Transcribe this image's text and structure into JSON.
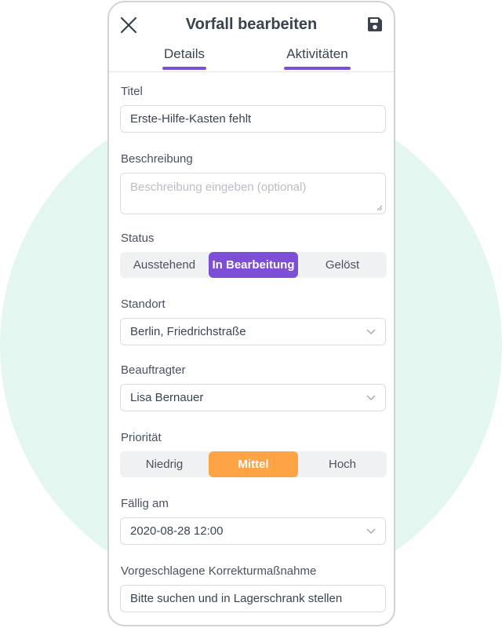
{
  "header": {
    "title": "Vorfall bearbeiten"
  },
  "tabs": [
    {
      "label": "Details",
      "active": true
    },
    {
      "label": "Aktivitäten",
      "active": false
    }
  ],
  "form": {
    "title": {
      "label": "Titel",
      "value": "Erste-Hilfe-Kasten fehlt"
    },
    "description": {
      "label": "Beschreibung",
      "value": "",
      "placeholder": "Beschreibung eingeben (optional)"
    },
    "status": {
      "label": "Status",
      "options": [
        "Ausstehend",
        "In Bearbeitung",
        "Gelöst"
      ],
      "selected": "In Bearbeitung"
    },
    "location": {
      "label": "Standort",
      "value": "Berlin, Friedrichstraße"
    },
    "assignee": {
      "label": "Beauftragter",
      "value": "Lisa Bernauer"
    },
    "priority": {
      "label": "Priorität",
      "options": [
        "Niedrig",
        "Mittel",
        "Hoch"
      ],
      "selected": "Mittel"
    },
    "due": {
      "label": "Fällig am",
      "value": "2020-08-28 12:00"
    },
    "corrective": {
      "label": "Vorgeschlagene Korrekturmaßnahme",
      "value": "Bitte suchen und in Lagerschrank stellen"
    }
  },
  "colors": {
    "accent": "#7c4fd6",
    "priority_active": "#ffa444",
    "background_circle": "#e3f6ef"
  },
  "icons": {
    "close": "close-icon",
    "save": "save-icon",
    "dropdown": "chevron-down-icon"
  }
}
